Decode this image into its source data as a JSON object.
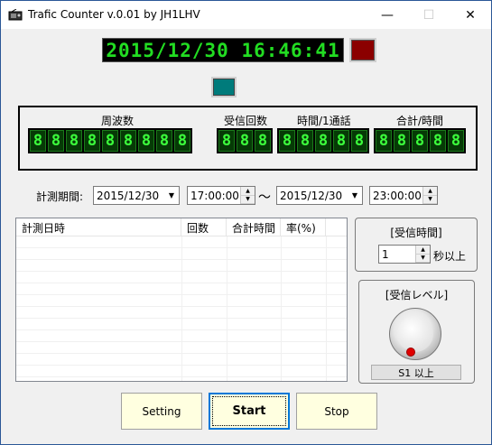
{
  "window": {
    "title": "Trafic Counter v.0.01 by JH1LHV",
    "minimize_glyph": "—",
    "maximize_glyph": "☐",
    "close_glyph": "✕"
  },
  "clock": {
    "display": "2015/12/30 16:46:41"
  },
  "counters": {
    "freq_label": "周波数",
    "freq_digits": [
      "8",
      "8",
      "8",
      "8",
      "8",
      "8",
      "8",
      "8",
      "8"
    ],
    "recv_label": "受信回数",
    "recv_digits": [
      "8",
      "8",
      "8"
    ],
    "time_per_label": "時間/1通話",
    "time_per_digits": [
      "8",
      "8",
      "8",
      "8",
      "8"
    ],
    "total_label": "合計/時間",
    "total_digits": [
      "8",
      "8",
      "8",
      "8",
      "8"
    ]
  },
  "period": {
    "label": "計測期間:",
    "start_date": "2015/12/30",
    "start_time": "17:00:00",
    "separator": "～",
    "end_date": "2015/12/30",
    "end_time": "23:00:00"
  },
  "list": {
    "columns": [
      "計測日時",
      "回数",
      "合計時間",
      "率(%)"
    ]
  },
  "recv_time_group": {
    "title": "[受信時間]",
    "value": "1",
    "unit": "秒以上"
  },
  "recv_level_group": {
    "title": "[受信レベル]",
    "button_label": "S1 以上"
  },
  "buttons": {
    "setting": "Setting",
    "start": "Start",
    "stop": "Stop"
  },
  "colors": {
    "segment_green": "#3cff3c",
    "indicator_red": "#8b0000",
    "indicator_teal": "#007b7b",
    "button_yellow": "#ffffe0"
  }
}
